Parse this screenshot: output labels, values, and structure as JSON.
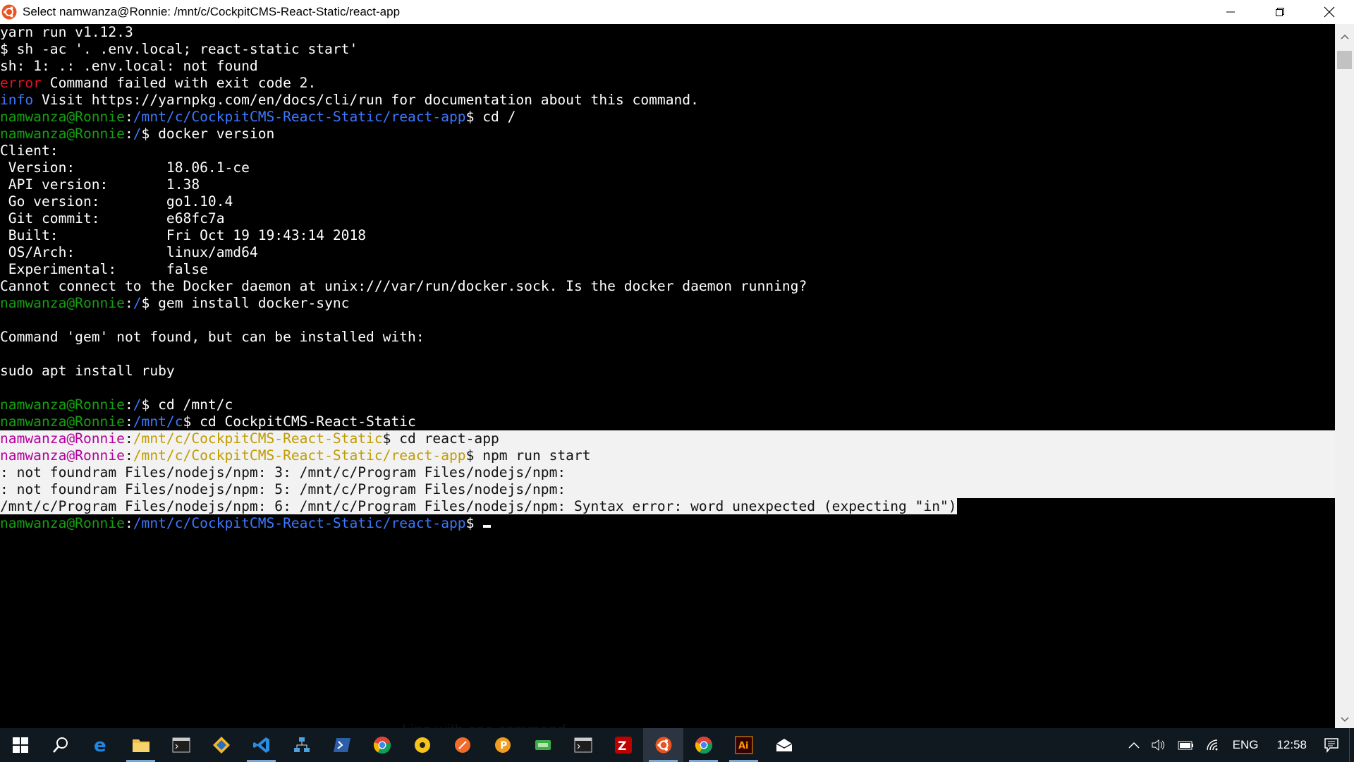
{
  "window": {
    "title": "Select namwanza@Ronnie: /mnt/c/CockpitCMS-React-Static/react-app"
  },
  "terminal": {
    "lines": [
      {
        "parts": [
          {
            "t": "yarn run v1.12.3"
          }
        ]
      },
      {
        "parts": [
          {
            "t": "$ sh -ac '. .env.local; react-static start'"
          }
        ]
      },
      {
        "parts": [
          {
            "t": "sh: 1: .: .env.local: not found"
          }
        ]
      },
      {
        "parts": [
          {
            "t": "error",
            "c": "err"
          },
          {
            "t": " Command failed with exit code 2."
          }
        ]
      },
      {
        "parts": [
          {
            "t": "info",
            "c": "info"
          },
          {
            "t": " Visit https://yarnpkg.com/en/docs/cli/run for documentation about this command."
          }
        ]
      },
      {
        "parts": [
          {
            "t": "namwanza@Ronnie",
            "c": "user"
          },
          {
            "t": ":"
          },
          {
            "t": "/mnt/c/CockpitCMS-React-Static/react-app",
            "c": "path"
          },
          {
            "t": "$ cd /"
          }
        ]
      },
      {
        "parts": [
          {
            "t": "namwanza@Ronnie",
            "c": "user"
          },
          {
            "t": ":"
          },
          {
            "t": "/",
            "c": "path"
          },
          {
            "t": "$ docker version"
          }
        ]
      },
      {
        "parts": [
          {
            "t": "Client:"
          }
        ]
      },
      {
        "parts": [
          {
            "t": " Version:           18.06.1-ce"
          }
        ]
      },
      {
        "parts": [
          {
            "t": " API version:       1.38"
          }
        ]
      },
      {
        "parts": [
          {
            "t": " Go version:        go1.10.4"
          }
        ]
      },
      {
        "parts": [
          {
            "t": " Git commit:        e68fc7a"
          }
        ]
      },
      {
        "parts": [
          {
            "t": " Built:             Fri Oct 19 19:43:14 2018"
          }
        ]
      },
      {
        "parts": [
          {
            "t": " OS/Arch:           linux/amd64"
          }
        ]
      },
      {
        "parts": [
          {
            "t": " Experimental:      false"
          }
        ]
      },
      {
        "parts": [
          {
            "t": "Cannot connect to the Docker daemon at unix:///var/run/docker.sock. Is the docker daemon running?"
          }
        ]
      },
      {
        "parts": [
          {
            "t": "namwanza@Ronnie",
            "c": "user"
          },
          {
            "t": ":"
          },
          {
            "t": "/",
            "c": "path"
          },
          {
            "t": "$ gem install docker-sync"
          }
        ]
      },
      {
        "parts": [
          {
            "t": ""
          }
        ]
      },
      {
        "parts": [
          {
            "t": "Command 'gem' not found, but can be installed with:"
          }
        ]
      },
      {
        "parts": [
          {
            "t": ""
          }
        ]
      },
      {
        "parts": [
          {
            "t": "sudo apt install ruby"
          }
        ]
      },
      {
        "parts": [
          {
            "t": ""
          }
        ]
      },
      {
        "parts": [
          {
            "t": "namwanza@Ronnie",
            "c": "user"
          },
          {
            "t": ":"
          },
          {
            "t": "/",
            "c": "path"
          },
          {
            "t": "$ cd /mnt/c"
          }
        ]
      },
      {
        "parts": [
          {
            "t": "namwanza@Ronnie",
            "c": "user"
          },
          {
            "t": ":"
          },
          {
            "t": "/mnt/c",
            "c": "path"
          },
          {
            "t": "$ cd CockpitCMS-React-Static"
          }
        ]
      },
      {
        "sel": "full",
        "parts": [
          {
            "t": "namwanza@Ronnie",
            "c": "user"
          },
          {
            "t": ":",
            "c": "txt"
          },
          {
            "t": "/mnt/c/CockpitCMS-React-Static",
            "c": "path"
          },
          {
            "t": "$ cd react-app",
            "c": "txt"
          }
        ]
      },
      {
        "sel": "full",
        "parts": [
          {
            "t": "namwanza@Ronnie",
            "c": "user"
          },
          {
            "t": ":",
            "c": "txt"
          },
          {
            "t": "/mnt/c/CockpitCMS-React-Static/react-app",
            "c": "path"
          },
          {
            "t": "$ npm run start",
            "c": "txt"
          }
        ]
      },
      {
        "sel": "full",
        "parts": [
          {
            "t": ": not foundram Files/nodejs/npm: 3: /mnt/c/Program Files/nodejs/npm:",
            "c": "txt"
          }
        ]
      },
      {
        "sel": "full",
        "parts": [
          {
            "t": ": not foundram Files/nodejs/npm: 5: /mnt/c/Program Files/nodejs/npm:",
            "c": "txt"
          }
        ]
      },
      {
        "sel": "part",
        "parts": [
          {
            "t": "/mnt/c/Program Files/nodejs/npm: 6: /mnt/c/Program Files/nodejs/npm: Syntax error: word unexpected (expecting \"in\")",
            "c": "txt"
          }
        ]
      },
      {
        "cursor": true,
        "parts": [
          {
            "t": "namwanza@Ronnie",
            "c": "user"
          },
          {
            "t": ":"
          },
          {
            "t": "/mnt/c/CockpitCMS-React-Static/react-app",
            "c": "path"
          },
          {
            "t": "$ "
          }
        ]
      }
    ]
  },
  "background_hint": "Line with one command",
  "taskbar": {
    "items": [
      {
        "name": "start-button",
        "icon": "windows-logo-icon"
      },
      {
        "name": "search-button",
        "icon": "search-icon"
      },
      {
        "name": "edge",
        "icon": "edge-icon"
      },
      {
        "name": "file-explorer",
        "icon": "folder-icon"
      },
      {
        "name": "terminal-1",
        "icon": "console-icon"
      },
      {
        "name": "sourcetree",
        "icon": "git-diamond-icon"
      },
      {
        "name": "vscode",
        "icon": "vscode-icon"
      },
      {
        "name": "network-app",
        "icon": "network-icon"
      },
      {
        "name": "powershell",
        "icon": "powershell-icon"
      },
      {
        "name": "chrome-1",
        "icon": "chrome-icon"
      },
      {
        "name": "yellow-app",
        "icon": "circle-yellow-icon"
      },
      {
        "name": "orange-app-1",
        "icon": "circle-orange-icon"
      },
      {
        "name": "orange-app-2",
        "icon": "circle-orange-p-icon"
      },
      {
        "name": "green-app",
        "icon": "green-app-icon"
      },
      {
        "name": "terminal-2",
        "icon": "console-icon"
      },
      {
        "name": "filezilla",
        "icon": "filezilla-icon"
      },
      {
        "name": "ubuntu",
        "icon": "ubuntu-icon"
      },
      {
        "name": "chrome-2",
        "icon": "chrome-icon"
      },
      {
        "name": "illustrator",
        "icon": "illustrator-icon"
      },
      {
        "name": "mail",
        "icon": "mail-icon"
      }
    ],
    "tray": {
      "language": "ENG",
      "time": "12:58"
    }
  },
  "colors": {
    "terminal_bg": "#000000",
    "prompt_user": "#13a10e",
    "prompt_path": "#3b78ff",
    "error": "#e81123",
    "selection": "#f2f2f2",
    "taskbar_bg": "#101820"
  }
}
